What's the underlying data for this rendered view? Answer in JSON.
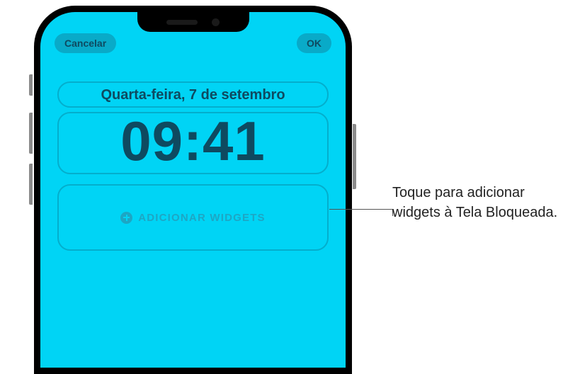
{
  "header": {
    "cancel_label": "Cancelar",
    "done_label": "OK"
  },
  "lockscreen": {
    "date": "Quarta-feira, 7 de setembro",
    "time": "09:41",
    "add_widgets_label": "ADICIONAR WIDGETS"
  },
  "callout": {
    "text": "Toque para adicionar widgets à Tela Bloqueada."
  }
}
